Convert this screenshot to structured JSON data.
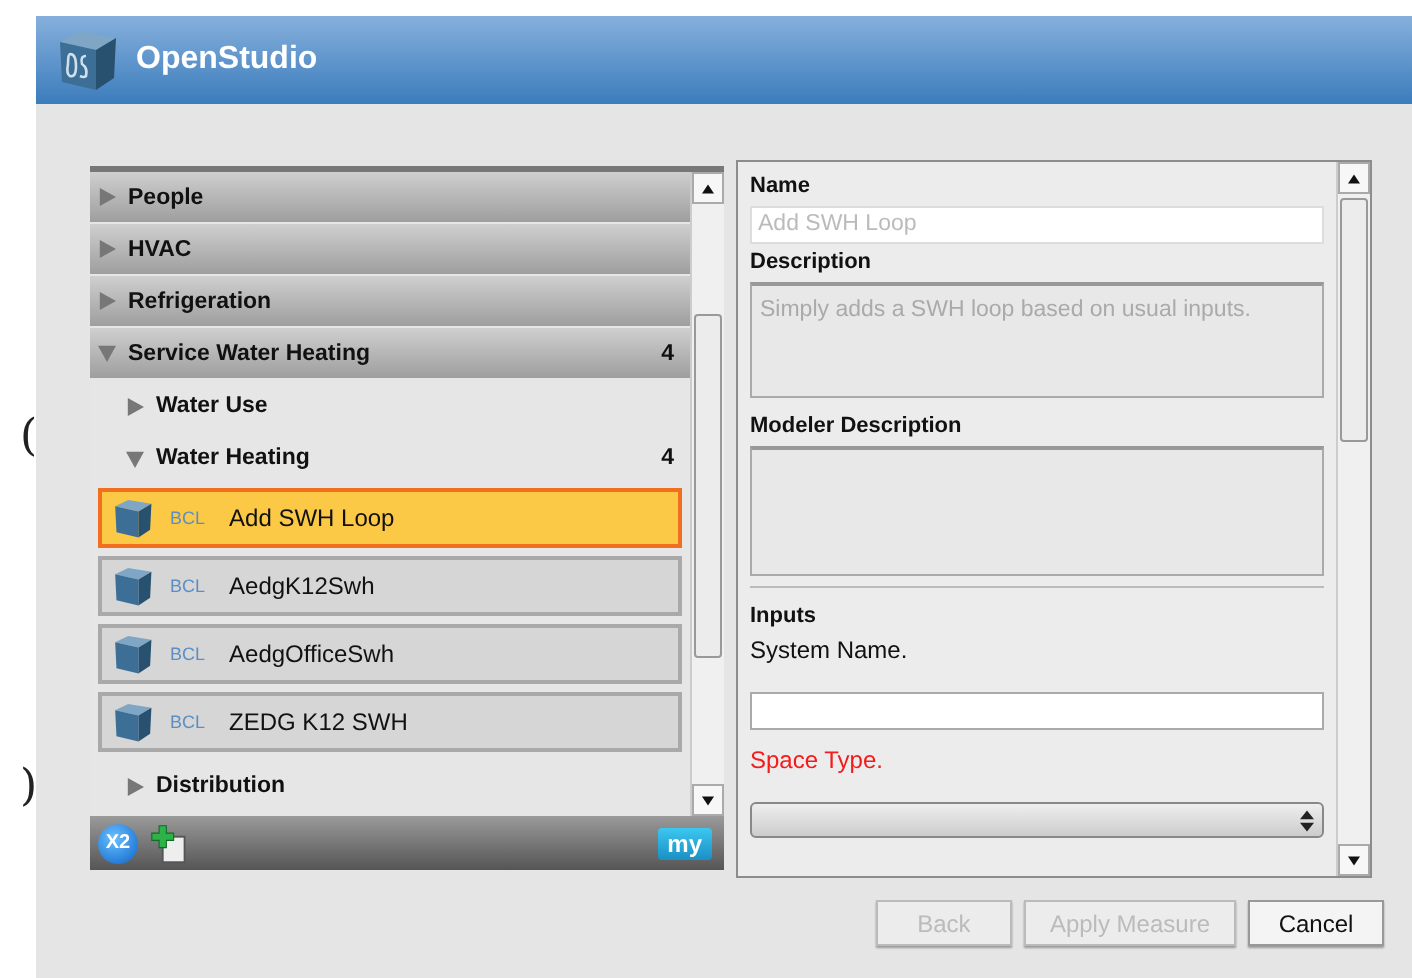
{
  "window": {
    "title": "OpenStudio"
  },
  "background_marks": [
    "(",
    ")"
  ],
  "library": {
    "categories": [
      {
        "label": "People",
        "expanded": false
      },
      {
        "label": "HVAC",
        "expanded": false
      },
      {
        "label": "Refrigeration",
        "expanded": false
      },
      {
        "label": "Service Water Heating",
        "expanded": true,
        "count": "4",
        "children": [
          {
            "label": "Water Use",
            "expanded": false
          },
          {
            "label": "Water Heating",
            "expanded": true,
            "count": "4",
            "measures": [
              {
                "source": "BCL",
                "name": "Add SWH Loop",
                "selected": true
              },
              {
                "source": "BCL",
                "name": "AedgK12Swh",
                "selected": false
              },
              {
                "source": "BCL",
                "name": "AedgOfficeSwh",
                "selected": false
              },
              {
                "source": "BCL",
                "name": "ZEDG K12 SWH",
                "selected": false
              }
            ]
          },
          {
            "label": "Distribution",
            "expanded": false
          }
        ]
      }
    ]
  },
  "toolbar": {
    "duplicate_label": "X2",
    "my_label": "my"
  },
  "details": {
    "name_label": "Name",
    "name_value": "Add SWH Loop",
    "description_label": "Description",
    "description": "Simply adds a SWH loop based on usual inputs.",
    "modeler_label": "Modeler Description",
    "inputs_label": "Inputs",
    "inputs": [
      {
        "kind": "text",
        "label": "System Name.",
        "required": false
      },
      {
        "kind": "choice",
        "label": "Space Type.",
        "required": true
      }
    ]
  },
  "buttons": [
    {
      "label": "Back",
      "disabled": true
    },
    {
      "label": "Apply Measure",
      "disabled": true
    },
    {
      "label": "Cancel",
      "disabled": false
    }
  ]
}
